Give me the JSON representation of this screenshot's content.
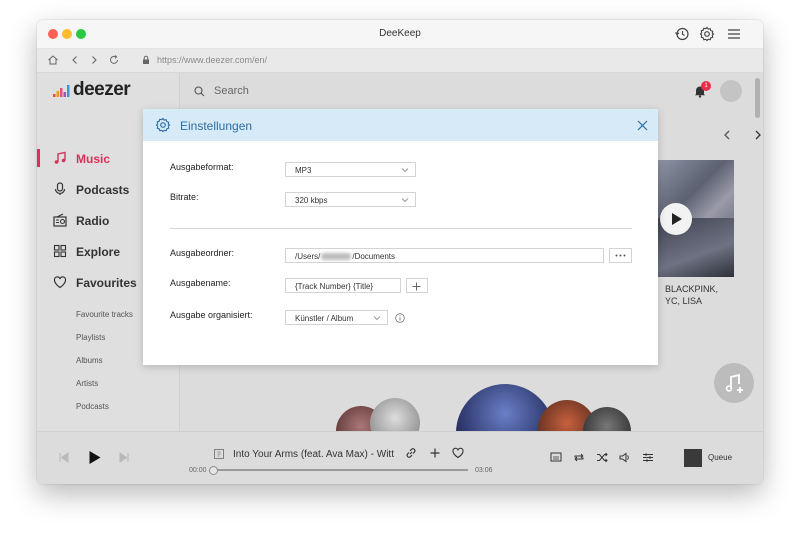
{
  "window": {
    "title": "DeeKeep",
    "url": "https://www.deezer.com/en/"
  },
  "sidebar": {
    "logo": "deezer",
    "nav": [
      {
        "label": "Music",
        "icon": "music-note-icon",
        "active": true
      },
      {
        "label": "Podcasts",
        "icon": "microphone-icon"
      },
      {
        "label": "Radio",
        "icon": "radio-icon"
      },
      {
        "label": "Explore",
        "icon": "grid-icon"
      },
      {
        "label": "Favourites",
        "icon": "heart-icon"
      }
    ],
    "sub": [
      "Favourite tracks",
      "Playlists",
      "Albums",
      "Artists",
      "Podcasts"
    ]
  },
  "header": {
    "search_placeholder": "Search",
    "notification_count": "1"
  },
  "album": {
    "caption_line1": "BLACKPINK,",
    "caption_line2": "YC, LISA"
  },
  "player": {
    "track_title": "Into Your Arms (feat. Ava Max) - Witt Lowry",
    "elapsed": "00:00",
    "duration": "03:06",
    "queue_label": "Queue",
    "progress": 0
  },
  "dialog": {
    "title": "Einstellungen",
    "output_format_label": "Ausgabeformat:",
    "output_format_value": "MP3",
    "bitrate_label": "Bitrate:",
    "bitrate_value": "320 kbps",
    "output_folder_label": "Ausgabeordner:",
    "output_folder_prefix": "/Users/",
    "output_folder_suffix": "/Documents",
    "output_name_label": "Ausgabename:",
    "output_name_value": "{Track Number} {Title}",
    "organize_label": "Ausgabe organisiert:",
    "organize_value": "Künstler / Album"
  },
  "colors": {
    "accent": "#d9315a",
    "dialog_header": "#d6eaf8",
    "dialog_title": "#2d6ea3",
    "badge": "#e8304b"
  }
}
